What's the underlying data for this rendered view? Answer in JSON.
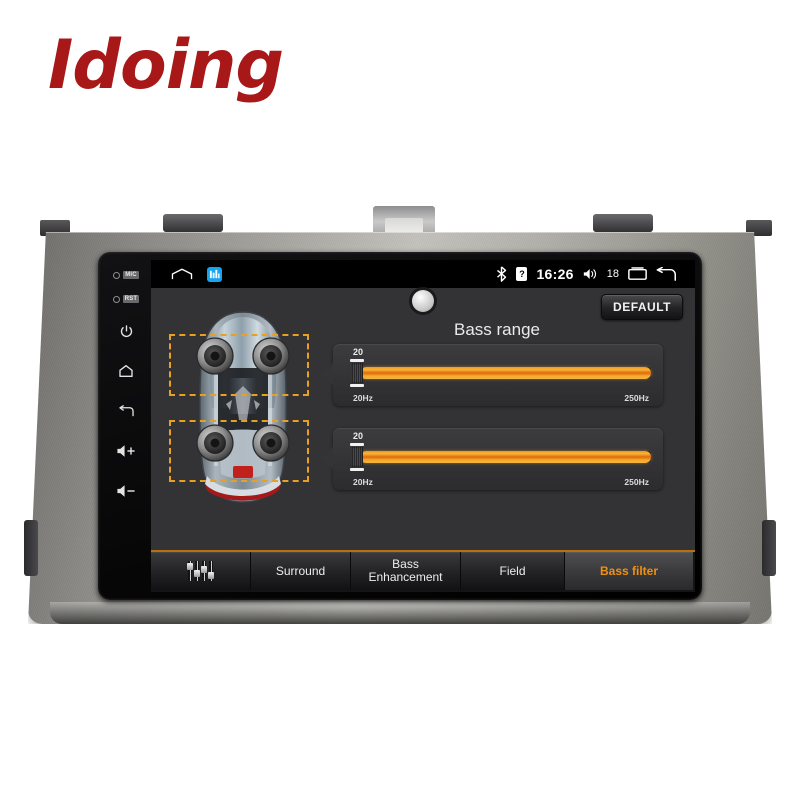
{
  "brand": {
    "logo_text": "Idoing"
  },
  "status_bar": {
    "home_icon": "home-icon",
    "app_icon": "media-app-icon",
    "bluetooth_icon": "bluetooth-icon",
    "storage_icon": "sd-card-icon",
    "storage_glyph": "?",
    "time": "16:26",
    "volume_icon": "speaker-icon",
    "volume_level": "18",
    "recents_icon": "recents-icon",
    "back_icon": "back-icon"
  },
  "hardware_buttons": {
    "mic_label": "MIC",
    "reset_label": "RST",
    "power": "power-icon",
    "home": "home-icon",
    "back": "back-icon",
    "volume_up": "+",
    "volume_down": "-"
  },
  "app": {
    "title": "Bass range",
    "default_button": "DEFAULT",
    "camera_dot": "camera-dot",
    "car_diagram": {
      "name": "car-top-view",
      "speaker_zones": [
        "front-speakers",
        "rear-speakers"
      ],
      "selection_color": "#e8a020"
    },
    "sliders": [
      {
        "name": "front-bass-range",
        "value": "20",
        "min_label": "20Hz",
        "max_label": "250Hz",
        "fill_percent": 100
      },
      {
        "name": "rear-bass-range",
        "value": "20",
        "min_label": "20Hz",
        "max_label": "250Hz",
        "fill_percent": 100
      }
    ],
    "tabs": [
      {
        "name": "equalizer",
        "label": "",
        "icon": "equalizer-icon",
        "active": false
      },
      {
        "name": "surround",
        "label": "Surround",
        "active": false
      },
      {
        "name": "bass-enhancement",
        "label_line1": "Bass",
        "label_line2": "Enhancement",
        "active": false
      },
      {
        "name": "field",
        "label": "Field",
        "active": false
      },
      {
        "name": "bass-filter",
        "label": "Bass filter",
        "active": true
      }
    ],
    "colors": {
      "accent": "#f0910f",
      "panel": "#333336",
      "track": "#1a1a1c"
    }
  }
}
